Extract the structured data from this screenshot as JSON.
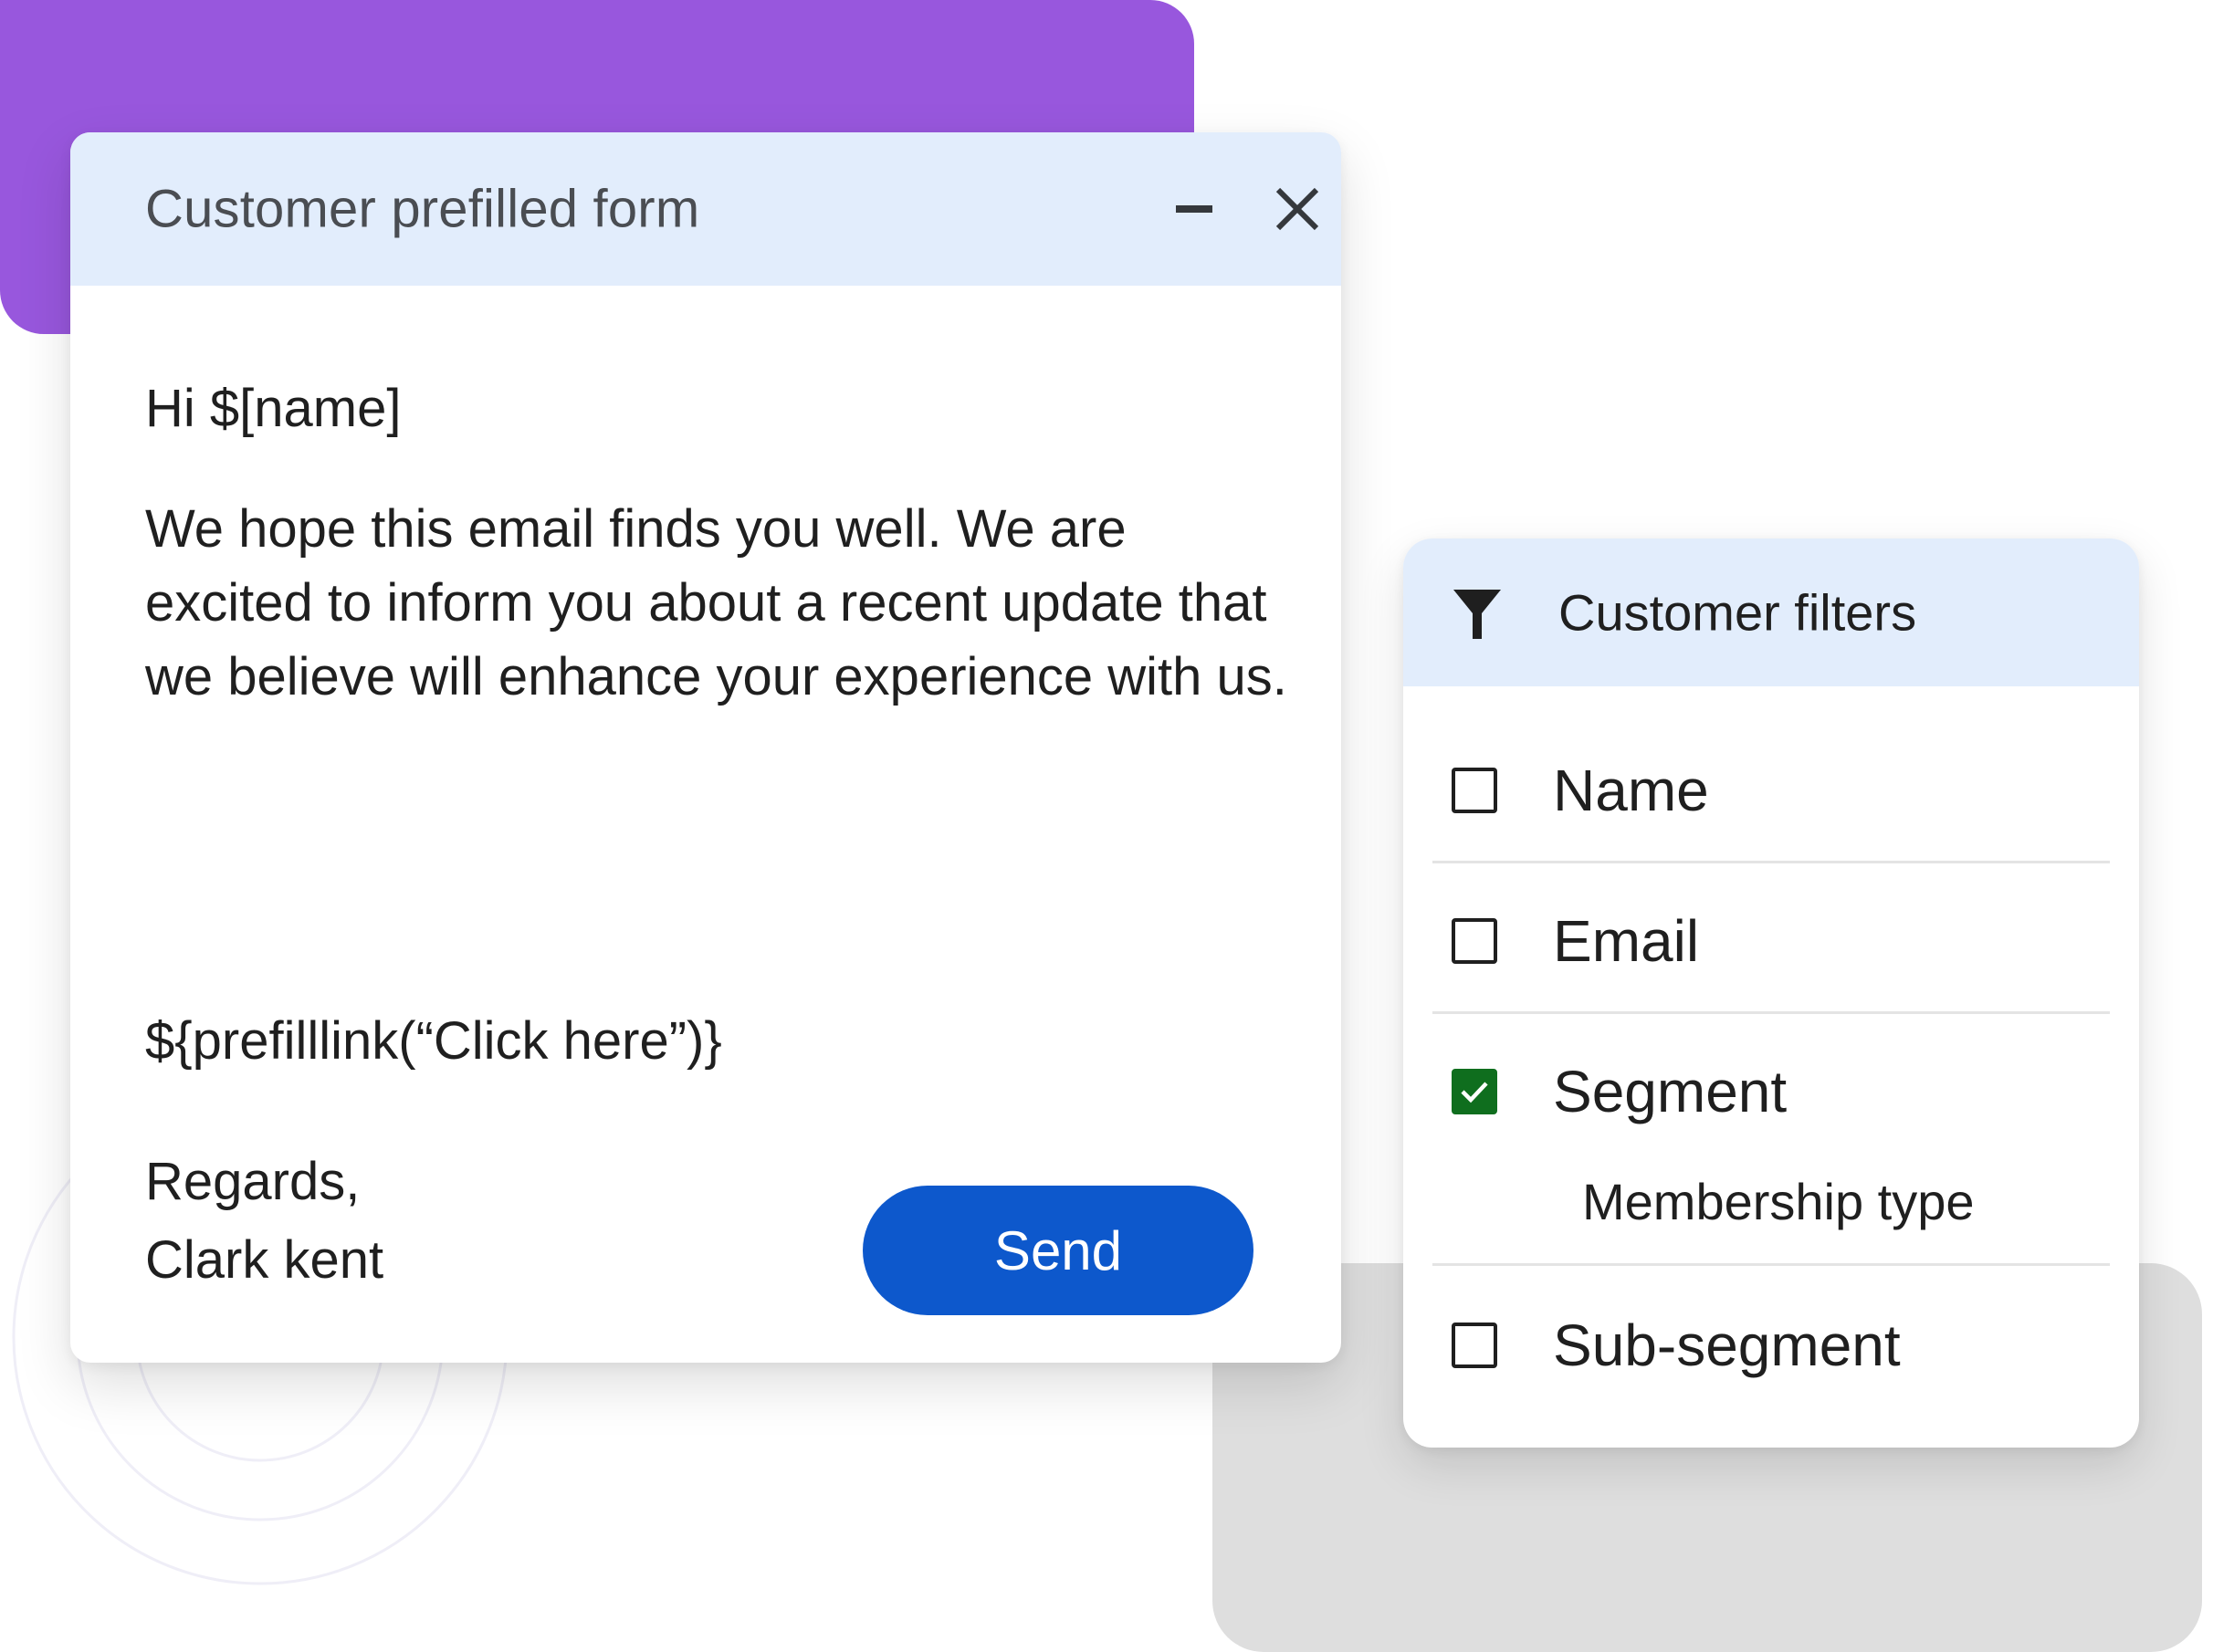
{
  "compose": {
    "title": "Customer prefilled form",
    "greeting": "Hi $[name]",
    "message": "We hope this email finds you well. We are excited to inform you about a recent update that we believe will enhance your experience with us.",
    "prefill_link": "${prefilllink(“Click here”)}",
    "regards": "Regards,",
    "signature": "Clark kent",
    "send_label": "Send"
  },
  "filters": {
    "title": "Customer filters",
    "items": [
      {
        "label": "Name",
        "checked": false
      },
      {
        "label": "Email",
        "checked": false
      },
      {
        "label": "Segment",
        "checked": true,
        "sub_label": "Membership type"
      },
      {
        "label": "Sub-segment",
        "checked": false
      }
    ]
  },
  "colors": {
    "accent_purple": "#9857DD",
    "header_tint": "#E2EDFC",
    "send_button": "#0D58CC",
    "checked_green": "#0F6E1E",
    "backdrop_gray": "#DEDEDE"
  },
  "icons": {
    "minimize": "minimize-icon",
    "close": "close-icon",
    "filter": "filter-funnel-icon",
    "checkmark": "checkmark-icon"
  }
}
